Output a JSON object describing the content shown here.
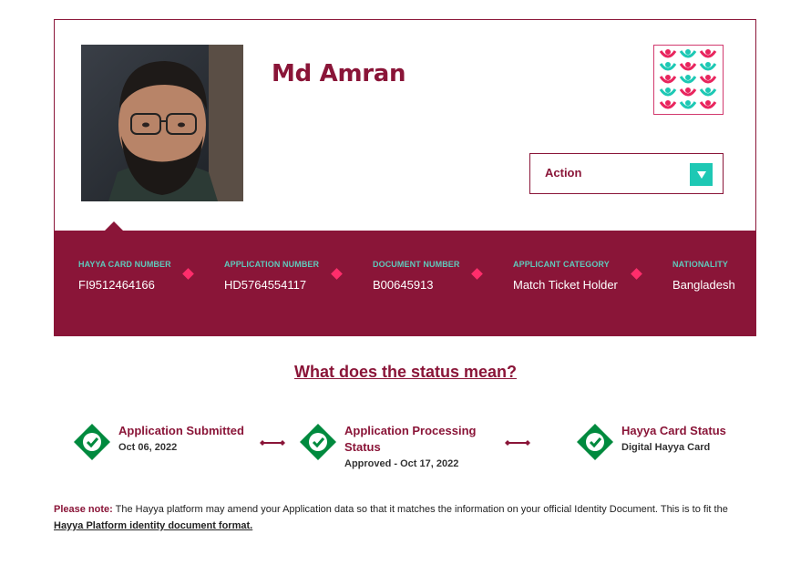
{
  "profile": {
    "name": "Md Amran"
  },
  "logo": {
    "icon": "hayya-logo-icon"
  },
  "action": {
    "label": "Action",
    "caret": "▼"
  },
  "details": [
    {
      "label": "HAYYA CARD NUMBER",
      "value": "FI9512464166"
    },
    {
      "label": "APPLICATION NUMBER",
      "value": "HD5764554117"
    },
    {
      "label": "DOCUMENT NUMBER",
      "value": "B00645913"
    },
    {
      "label": "APPLICANT CATEGORY",
      "value": "Match Ticket Holder"
    },
    {
      "label": "NATIONALITY",
      "value": "Bangladesh"
    }
  ],
  "status_link": "What does the status mean?",
  "steps": [
    {
      "title": "Application Submitted",
      "sub": "Oct 06, 2022"
    },
    {
      "title_line1": "Application Processing",
      "title_line2": "Status",
      "sub": "Approved - Oct 17, 2022"
    },
    {
      "title": "Hayya Card Status",
      "sub": "Digital Hayya Card"
    }
  ],
  "note": {
    "label": "Please note:",
    "text": " The Hayya platform may amend your Application data so that it matches the information on your official Identity Document. This is to fit the ",
    "link": "Hayya Platform identity document format."
  },
  "colors": {
    "maroon": "#8a1538",
    "teal": "#1ec8b4",
    "pink": "#ff2d6b",
    "green": "#008a3e"
  }
}
